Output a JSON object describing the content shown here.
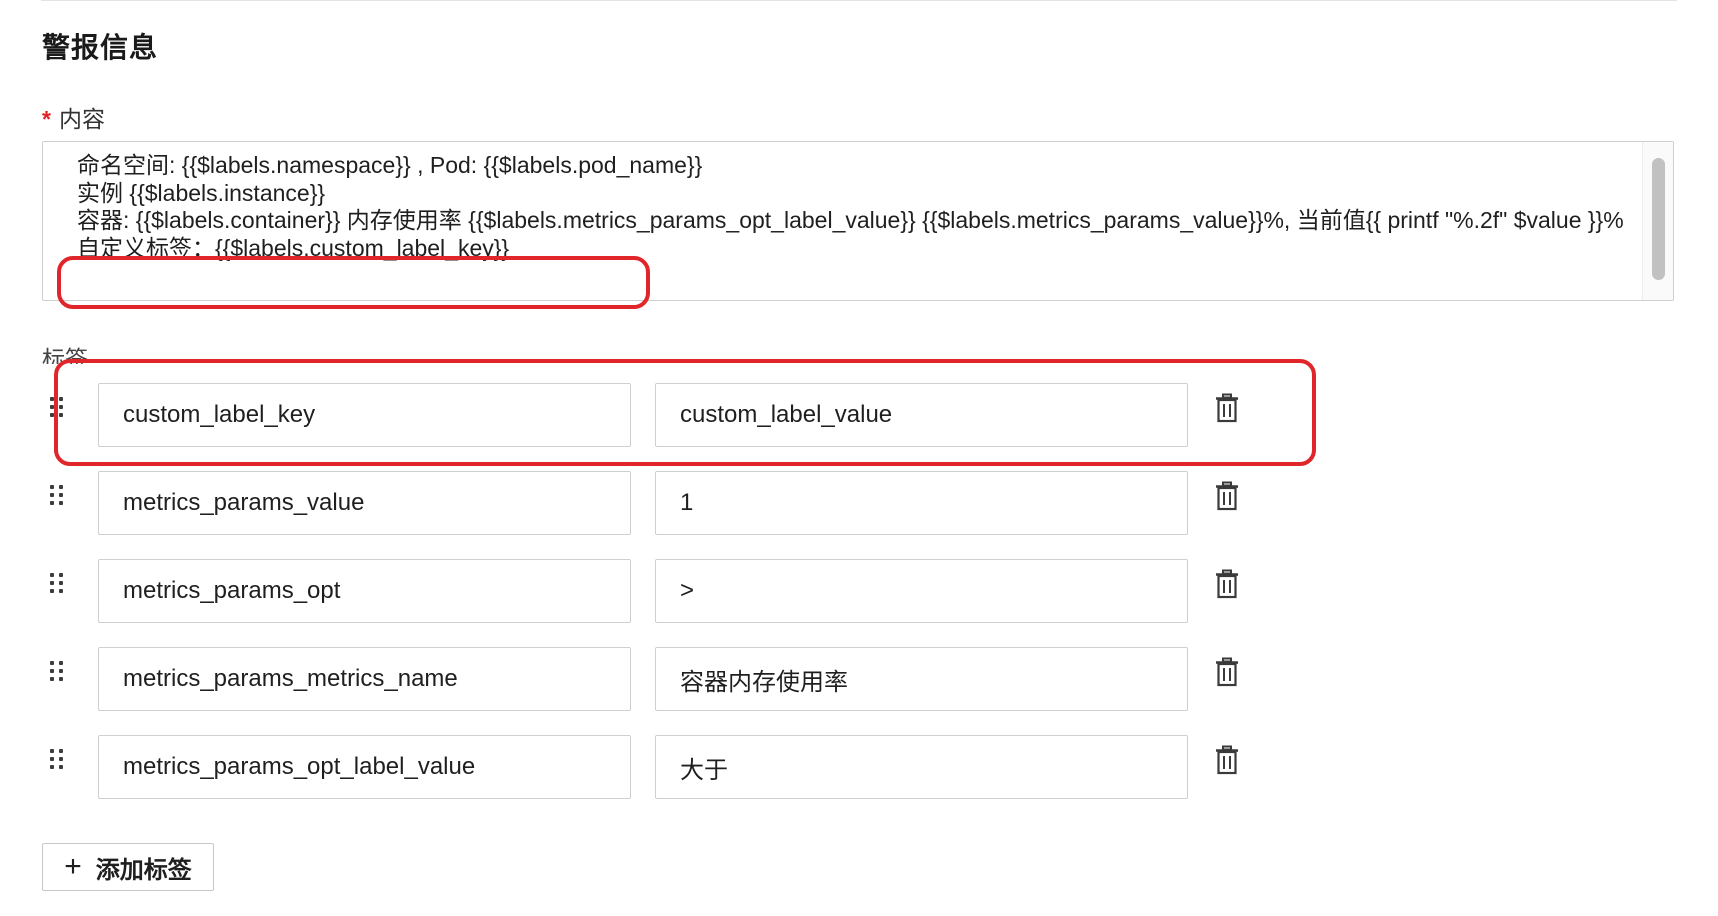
{
  "section": {
    "title": "警报信息"
  },
  "content": {
    "required_mark": "*",
    "label": "内容",
    "text": "命名空间: {{$labels.namespace}} , Pod: {{$labels.pod_name}}\n实例 {{$labels.instance}}\n容器: {{$labels.container}} 内存使用率 {{$labels.metrics_params_opt_label_value}} {{$labels.metrics_params_value}}%, 当前值{{ printf \"%.2f\" $value }}%\n自定义标签：{{$labels.custom_label_key}}"
  },
  "labels": {
    "title": "标签",
    "rows": [
      {
        "key": "custom_label_key",
        "value": "custom_label_value"
      },
      {
        "key": "metrics_params_value",
        "value": "1"
      },
      {
        "key": "metrics_params_opt",
        "value": ">"
      },
      {
        "key": "metrics_params_metrics_name",
        "value": "容器内存使用率"
      },
      {
        "key": "metrics_params_opt_label_value",
        "value": "大于"
      }
    ]
  },
  "add_button": {
    "icon": "plus-icon",
    "label": "添加标签"
  },
  "colors": {
    "highlight": "#e0262a",
    "required": "#e02020",
    "border": "#cfcfcf"
  },
  "icons": {
    "row_handle": "drag-handle-icon",
    "row_delete": "trash-icon"
  }
}
